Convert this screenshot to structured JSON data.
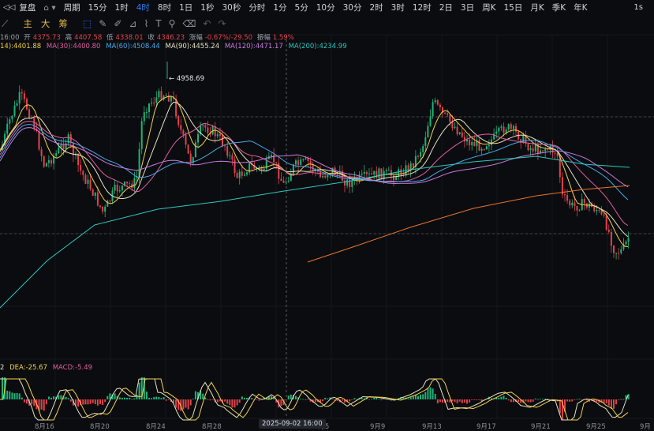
{
  "toolbar": {
    "symbol_label": "复盘",
    "period_label": "周期",
    "timeframes": [
      "15分",
      "1时",
      "4时",
      "8时",
      "1日",
      "1秒",
      "30秒",
      "分时",
      "1分",
      "5分",
      "10分",
      "30分",
      "2时",
      "3时",
      "12时",
      "2日",
      "3日",
      "周K",
      "15日",
      "月K",
      "季K",
      "年K"
    ],
    "active_timeframe": "4时",
    "right_label": "1s"
  },
  "tools": {
    "labels": [
      "主",
      "大",
      "筹"
    ],
    "icons": [
      "select-icon",
      "pen-icon",
      "pencil-icon",
      "ruler-icon",
      "brush-icon",
      "text-icon",
      "funnel-icon",
      "trash-icon",
      "undo-icon",
      "redo-icon"
    ],
    "selected_icon": "select-icon"
  },
  "ohlc": {
    "time": "16:00",
    "open_label": "开",
    "open": "4375.73",
    "high_label": "高",
    "high": "4407.58",
    "low_label": "低",
    "low": "4338.01",
    "close_label": "收",
    "close": "4346.23",
    "change_label": "涨幅",
    "change": "-0.67%/-29.50",
    "amp_label": "振幅",
    "amp": "1.59%"
  },
  "ma_legend": [
    {
      "text": "14):4401.88",
      "color": "#f2d24a"
    },
    {
      "text": "MA(30):4400.80",
      "color": "#e05fa2"
    },
    {
      "text": "MA(60):4508.44",
      "color": "#4aa8e8"
    },
    {
      "text": "MA(90):4455.24",
      "color": "#e8e2c4"
    },
    {
      "text": "MA(120):4471.17",
      "color": "#c97ce0"
    },
    {
      "text": "MA(200):4234.99",
      "color": "#2ec7c0"
    }
  ],
  "annotation": {
    "high_marker": "← 4958.69"
  },
  "macd": {
    "dif": "2",
    "dea": "DEA:-25.67",
    "macd": "MACD:-5.49"
  },
  "xaxis": {
    "labels": [
      "8月16",
      "8月20",
      "8月24",
      "8月28",
      "9月5",
      "9月9",
      "9月13",
      "9月17",
      "9月21",
      "9月25",
      "9月"
    ],
    "crosshair_time": "2025-09-02 16:00"
  },
  "colors": {
    "up": "#1fb37a",
    "down": "#e0434b",
    "accent": "#2f7bf5",
    "background": "#0b0c0f"
  }
}
